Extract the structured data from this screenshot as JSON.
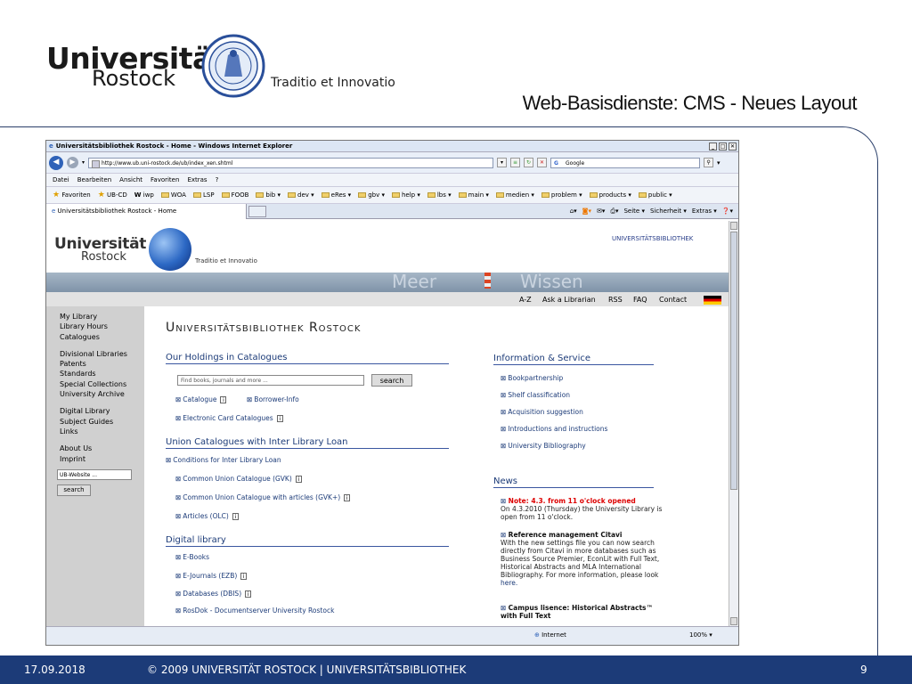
{
  "slide": {
    "logo_line1": "Universität",
    "logo_line2": "Rostock",
    "motto": "Traditio et Innovatio",
    "title": "Web-Basisdienste: CMS - Neues Layout",
    "footer_date": "17.09.2018",
    "footer_text": "© 2009 UNIVERSITÄT ROSTOCK | UNIVERSITÄTSBIBLIOTHEK",
    "page_number": "9"
  },
  "browser": {
    "title": "Universitätsbibliothek Rostock - Home - Windows Internet Explorer",
    "url": "http://www.ub.uni-rostock.de/ub/index_xen.shtml",
    "search_engine": "Google",
    "menu": [
      "Datei",
      "Bearbeiten",
      "Ansicht",
      "Favoriten",
      "Extras",
      "?"
    ],
    "favorites_label": "Favoriten",
    "favorites": [
      "UB-CD",
      "iwp",
      "WOA",
      "LSP",
      "FOOB",
      "bib ▾",
      "dev ▾",
      "eRes ▾",
      "gbv ▾",
      "help ▾",
      "lbs ▾",
      "main ▾",
      "medien ▾",
      "problem ▾",
      "products ▾",
      "public ▾"
    ],
    "tab_title": "Universitätsbibliothek Rostock - Home",
    "tools": [
      "Seite ▾",
      "Sicherheit ▾",
      "Extras ▾",
      "❓▾"
    ],
    "status_zone": "Internet",
    "status_zoom": "100% ▾"
  },
  "page": {
    "logo_line1": "Universität",
    "logo_line2": "Rostock",
    "motto": "Traditio et Innovatio",
    "top_right": "UNIVERSITÄTSBIBLIOTHEK",
    "banner_word1": "Meer",
    "banner_word2": "Wissen",
    "topnav": [
      "A-Z",
      "Ask a Librarian",
      "RSS",
      "FAQ",
      "Contact"
    ],
    "leftnav_group1": [
      "My Library",
      "Library Hours",
      "Catalogues"
    ],
    "leftnav_group2": [
      "Divisional Libraries",
      "Patents",
      "Standards",
      "Special Collections",
      "University Archive"
    ],
    "leftnav_group3": [
      "Digital Library",
      "Subject Guides",
      "Links"
    ],
    "leftnav_group4": [
      "About Us",
      "Imprint"
    ],
    "left_search_placeholder": "UB-Website ...",
    "left_search_button": "search",
    "heading": "Universitätsbibliothek Rostock",
    "holdings": {
      "title": "Our Holdings in Catalogues",
      "search_placeholder": "Find books, journals and more ...",
      "search_button": "search",
      "link1": "Catalogue",
      "link2": "Borrower-Info",
      "link3": "Electronic Card Catalogues"
    },
    "union": {
      "title": "Union Catalogues with Inter Library Loan",
      "links": [
        "Conditions for Inter Library Loan",
        "Common Union Catalogue (GVK)",
        "Common Union Catalogue with articles (GVK+)",
        "Articles (OLC)"
      ]
    },
    "digital": {
      "title": "Digital library",
      "links": [
        "E-Books",
        "E-Journals (EZB)",
        "Databases (DBIS)",
        "RosDok - Documentserver University Rostock"
      ]
    },
    "info": {
      "title": "Information & Service",
      "links": [
        "Bookpartnership",
        "Shelf classification",
        "Acquisition suggestion",
        "Introductions and instructions",
        "University Bibliography"
      ]
    },
    "news": {
      "title": "News",
      "item1_head": "Note: 4.3. from 11 o'clock opened",
      "item1_body": "On 4.3.2010 (Thursday) the University Library is open from 11 o'clock.",
      "item2_head": "Reference management Citavi",
      "item2_body": "With the new settings file you can now search directly from Citavi in more databases such as Business Source Premier, EconLit with Full Text, Historical Abstracts and MLA International Bibliography. For more information, please look",
      "item2_link": "here.",
      "item3_head": "Campus lisence: Historical Abstracts™ with Full Text"
    }
  }
}
